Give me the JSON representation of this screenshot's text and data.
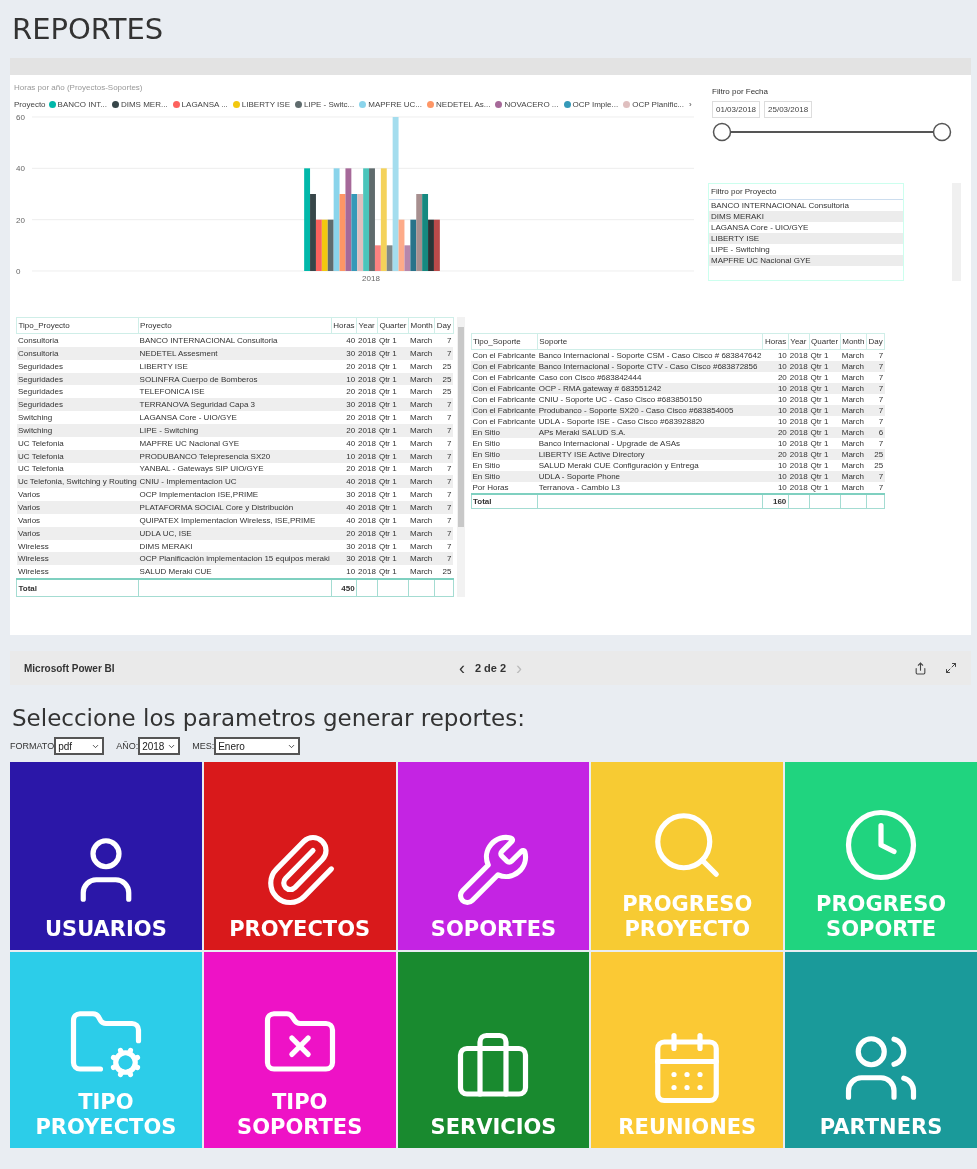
{
  "page_title": "REPORTES",
  "report": {
    "chart": {
      "legend_title": "Proyecto",
      "legend_more": "›",
      "chart_data": {
        "type": "bar",
        "legend": "top",
        "title": "Horas por año (Proyectos-Soportes)",
        "categories": [
          "2018"
        ],
        "ylim": [
          0,
          60
        ],
        "yticks": [
          0,
          20,
          40,
          60
        ],
        "series": [
          {
            "name": "BANCO INT...",
            "color": "#01b8aa",
            "values": [
              40
            ]
          },
          {
            "name": "DIMS MER...",
            "color": "#374649",
            "values": [
              30
            ]
          },
          {
            "name": "LAGANSA ...",
            "color": "#fd625e",
            "values": [
              20
            ]
          },
          {
            "name": "LIBERTY ISE",
            "color": "#f2c80f",
            "values": [
              20
            ]
          },
          {
            "name": "LIPE - Switc...",
            "color": "#5f6b6d",
            "values": [
              20
            ]
          },
          {
            "name": "MAPFRE UC...",
            "color": "#8ad4eb",
            "values": [
              40
            ]
          },
          {
            "name": "NEDETEL As...",
            "color": "#fe9666",
            "values": [
              30
            ]
          },
          {
            "name": "NOVACERO ...",
            "color": "#a66999",
            "values": [
              40
            ]
          },
          {
            "name": "OCP Imple...",
            "color": "#3599b8",
            "values": [
              30
            ]
          },
          {
            "name": "OCP Planific...",
            "color": "#dfbfbf",
            "values": [
              30
            ]
          },
          {
            "color": "#4ac5bb",
            "values": [
              40
            ]
          },
          {
            "color": "#5f6b6d",
            "values": [
              40
            ]
          },
          {
            "color": "#fb8281",
            "values": [
              10
            ]
          },
          {
            "color": "#f4d25a",
            "values": [
              40
            ]
          },
          {
            "color": "#7f898a",
            "values": [
              10
            ]
          },
          {
            "color": "#a4ddee",
            "values": [
              60
            ]
          },
          {
            "color": "#fdab89",
            "values": [
              20
            ]
          },
          {
            "color": "#b687ac",
            "values": [
              10
            ]
          },
          {
            "color": "#28738a",
            "values": [
              20
            ]
          },
          {
            "color": "#a78f8f",
            "values": [
              30
            ]
          },
          {
            "color": "#168980",
            "values": [
              30
            ]
          },
          {
            "color": "#293537",
            "values": [
              20
            ]
          },
          {
            "color": "#bb4a4a",
            "values": [
              20
            ]
          }
        ]
      }
    },
    "date_filter": {
      "title": "Filtro por Fecha",
      "start": "01/03/2018",
      "end": "25/03/2018",
      "level": 1
    },
    "project_filter": {
      "title": "Filtro por Proyecto",
      "items": [
        "BANCO INTERNACIONAL Consultoria",
        "DIMS MERAKI",
        "LAGANSA Core - UIO/GYE",
        "LIBERTY ISE",
        "LIPE - Switching",
        "MAPFRE UC Nacional GYE"
      ]
    },
    "projects_table": {
      "columns": [
        "Tipo_Proyecto",
        "Proyecto",
        "Horas",
        "Year",
        "Quarter",
        "Month",
        "Day"
      ],
      "rows": [
        [
          "Consultoria",
          "BANCO INTERNACIONAL Consultoria",
          "40",
          "2018",
          "Qtr 1",
          "March",
          "7"
        ],
        [
          "Consultoria",
          "NEDETEL Assesment",
          "30",
          "2018",
          "Qtr 1",
          "March",
          "7"
        ],
        [
          "Seguridades",
          "LIBERTY ISE",
          "20",
          "2018",
          "Qtr 1",
          "March",
          "25"
        ],
        [
          "Seguridades",
          "SOLINFRA Cuerpo de Bomberos",
          "10",
          "2018",
          "Qtr 1",
          "March",
          "25"
        ],
        [
          "Seguridades",
          "TELEFONICA ISE",
          "20",
          "2018",
          "Qtr 1",
          "March",
          "25"
        ],
        [
          "Seguridades",
          "TERRANOVA Seguridad Capa 3",
          "30",
          "2018",
          "Qtr 1",
          "March",
          "7"
        ],
        [
          "Switching",
          "LAGANSA Core - UIO/GYE",
          "20",
          "2018",
          "Qtr 1",
          "March",
          "7"
        ],
        [
          "Switching",
          "LIPE - Switching",
          "20",
          "2018",
          "Qtr 1",
          "March",
          "7"
        ],
        [
          "UC Telefonia",
          "MAPFRE UC Nacional GYE",
          "40",
          "2018",
          "Qtr 1",
          "March",
          "7"
        ],
        [
          "UC Telefonia",
          "PRODUBANCO Telepresencia SX20",
          "10",
          "2018",
          "Qtr 1",
          "March",
          "7"
        ],
        [
          "UC Telefonia",
          "YANBAL - Gateways SIP UIO/GYE",
          "20",
          "2018",
          "Qtr 1",
          "March",
          "7"
        ],
        [
          "Uc Telefonia, Switching y Routing",
          "CNIU - Implementacion UC",
          "40",
          "2018",
          "Qtr 1",
          "March",
          "7"
        ],
        [
          "Varios",
          "OCP Implementacion ISE,PRIME",
          "30",
          "2018",
          "Qtr 1",
          "March",
          "7"
        ],
        [
          "Varios",
          "PLATAFORMA SOCIAL Core y Distribución",
          "40",
          "2018",
          "Qtr 1",
          "March",
          "7"
        ],
        [
          "Varios",
          "QUIPATEX Implementacion Wireless, ISE,PRIME",
          "40",
          "2018",
          "Qtr 1",
          "March",
          "7"
        ],
        [
          "Varios",
          "UDLA UC, ISE",
          "20",
          "2018",
          "Qtr 1",
          "March",
          "7"
        ],
        [
          "Wireless",
          "DIMS MERAKI",
          "30",
          "2018",
          "Qtr 1",
          "March",
          "7"
        ],
        [
          "Wireless",
          "OCP Planificación implementacion 15 equipos meraki",
          "30",
          "2018",
          "Qtr 1",
          "March",
          "7"
        ],
        [
          "Wireless",
          "SALUD Meraki CUE",
          "10",
          "2018",
          "Qtr 1",
          "March",
          "25"
        ]
      ],
      "total_label": "Total",
      "total_hours": "450"
    },
    "support_table": {
      "columns": [
        "Tipo_Soporte",
        "Soporte",
        "Horas",
        "Year",
        "Quarter",
        "Month",
        "Day"
      ],
      "rows": [
        [
          "Con el Fabricante",
          "Banco Internacional - Soporte CSM - Caso Cisco # 683847642",
          "10",
          "2018",
          "Qtr 1",
          "March",
          "7"
        ],
        [
          "Con el Fabricante",
          "Banco Internacional - Soporte CTV - Caso Cisco #683872856",
          "10",
          "2018",
          "Qtr 1",
          "March",
          "7"
        ],
        [
          "Con el Fabricante",
          "Caso con Cisco #683842444",
          "20",
          "2018",
          "Qtr 1",
          "March",
          "7"
        ],
        [
          "Con el Fabricante",
          "OCP - RMA gateway # 683551242",
          "10",
          "2018",
          "Qtr 1",
          "March",
          "7"
        ],
        [
          "Con el Fabricante",
          "CNIU - Soporte UC - Caso Cisco #683850150",
          "10",
          "2018",
          "Qtr 1",
          "March",
          "7"
        ],
        [
          "Con el Fabricante",
          "Produbanco - Soporte SX20 - Caso Cisco #683854005",
          "10",
          "2018",
          "Qtr 1",
          "March",
          "7"
        ],
        [
          "Con el Fabricante",
          "UDLA - Soporte ISE - Caso Cisco #683928820",
          "10",
          "2018",
          "Qtr 1",
          "March",
          "7"
        ],
        [
          "En Sitio",
          "APs Meraki SALUD S.A.",
          "20",
          "2018",
          "Qtr 1",
          "March",
          "6"
        ],
        [
          "En Sitio",
          "Banco Internacional - Upgrade de ASAs",
          "10",
          "2018",
          "Qtr 1",
          "March",
          "7"
        ],
        [
          "En Sitio",
          "LIBERTY ISE Active Directory",
          "20",
          "2018",
          "Qtr 1",
          "March",
          "25"
        ],
        [
          "En Sitio",
          "SALUD Meraki CUE Configuración y Entrega",
          "10",
          "2018",
          "Qtr 1",
          "March",
          "25"
        ],
        [
          "En Sitio",
          "UDLA - Soporte Phone",
          "10",
          "2018",
          "Qtr 1",
          "March",
          "7"
        ],
        [
          "Por Horas",
          "Terranova - Cambio L3",
          "10",
          "2018",
          "Qtr 1",
          "March",
          "7"
        ]
      ],
      "total_label": "Total",
      "total_hours": "160"
    },
    "footer": {
      "brand": "Microsoft Power BI",
      "prev": "‹",
      "page": "2 de 2",
      "next": "›",
      "next_disabled": true
    }
  },
  "form": {
    "heading": "Seleccione los parametros generar reportes:",
    "fields": [
      {
        "label": "FORMATO",
        "value": "pdf"
      },
      {
        "label": "AÑO:",
        "value": "2018"
      },
      {
        "label": "MES:",
        "value": "Enero"
      }
    ]
  },
  "tiles": [
    {
      "label": "USUARIOS",
      "color": "#2b17a8"
    },
    {
      "label": "PROYECTOS",
      "color": "#d9191b"
    },
    {
      "label": "SOPORTES",
      "color": "#c424e3"
    },
    {
      "label": "PROGRESO PROYECTO",
      "color": "#f7cb33"
    },
    {
      "label": "PROGRESO SOPORTE",
      "color": "#20d47f"
    },
    {
      "label": "TIPO PROYECTOS",
      "color": "#2ccde9"
    },
    {
      "label": "TIPO SOPORTES",
      "color": "#ee12c6"
    },
    {
      "label": "SERVICIOS",
      "color": "#198a2f"
    },
    {
      "label": "REUNIONES",
      "color": "#fbc934"
    },
    {
      "label": "PARTNERS",
      "color": "#1a9a9a"
    }
  ]
}
